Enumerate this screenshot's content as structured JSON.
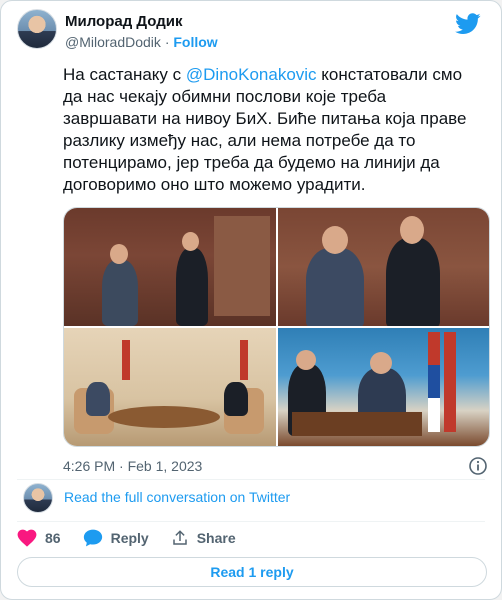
{
  "author": {
    "display_name": "Милорад Додик",
    "handle": "@MiloradDodik",
    "separator": "·",
    "follow_label": "Follow"
  },
  "tweet": {
    "text_before": "На састанаку с ",
    "mention": "@DinoKonakovic",
    "text_after": " констатовали смо да  нас чекају обимни послови које треба завршавати на нивоу БиХ. Биће питања која праве разлику између нас, али нема потребе да то потенцирамо, јер треба да будемо на линији да договоримо оно што можемо урадити."
  },
  "media": {
    "count": 4
  },
  "meta": {
    "timestamp": "4:26 PM · Feb 1, 2023"
  },
  "conversation": {
    "link_label": "Read the full conversation on Twitter"
  },
  "actions": {
    "like_count": "86",
    "reply_label": "Reply",
    "share_label": "Share"
  },
  "read_replies": {
    "label": "Read 1 reply"
  },
  "colors": {
    "accent": "#1d9bf0",
    "like": "#f91880",
    "text": "#0f1419",
    "secondary": "#536471"
  }
}
